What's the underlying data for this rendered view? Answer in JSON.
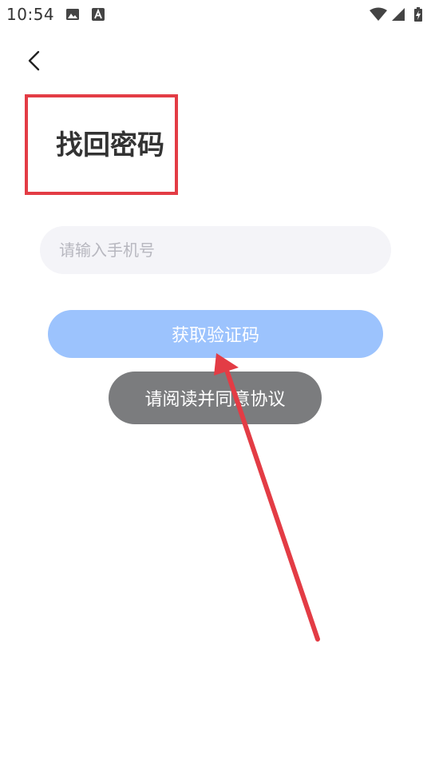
{
  "status_bar": {
    "time": "10:54",
    "icons": [
      "image-icon",
      "text-a-icon",
      "wifi-icon",
      "signal-icon",
      "battery-charging-icon"
    ]
  },
  "header": {
    "back_icon": "chevron-left-icon",
    "title": "找回密码"
  },
  "form": {
    "phone_placeholder": "请输入手机号",
    "phone_value": "",
    "get_code_label": "获取验证码"
  },
  "toast": {
    "message": "请阅读并同意协议"
  },
  "colors": {
    "primary_button": "#9cc3fd",
    "toast_bg": "#7b7c7e",
    "annotation_red": "#e33c45",
    "input_bg": "#f4f4f8"
  }
}
